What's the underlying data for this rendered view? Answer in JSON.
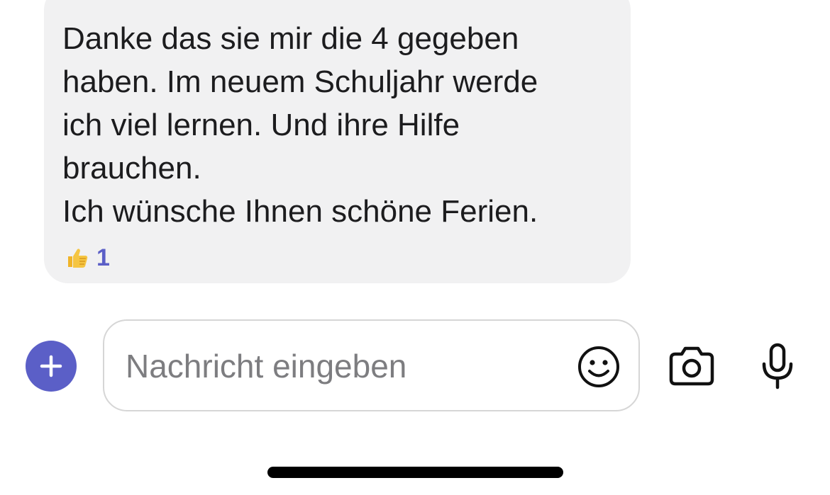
{
  "message": {
    "lines": [
      "Danke das sie mir die 4 gegeben",
      "haben. Im neuem Schuljahr werde",
      "ich viel lernen. Und ihre Hilfe",
      "brauchen.",
      "Ich wünsche Ihnen schöne Ferien."
    ],
    "reaction": {
      "emoji": "thumbs-up-icon",
      "count": "1"
    }
  },
  "composer": {
    "add_icon": "plus-icon",
    "placeholder": "Nachricht eingeben",
    "value": "",
    "emoji_icon": "smiley-icon",
    "camera_icon": "camera-icon",
    "mic_icon": "microphone-icon"
  },
  "colors": {
    "accent": "#5b5fc7",
    "bubble_bg": "#f1f1f2",
    "text": "#1c1c1e",
    "placeholder": "#7d7d80"
  }
}
